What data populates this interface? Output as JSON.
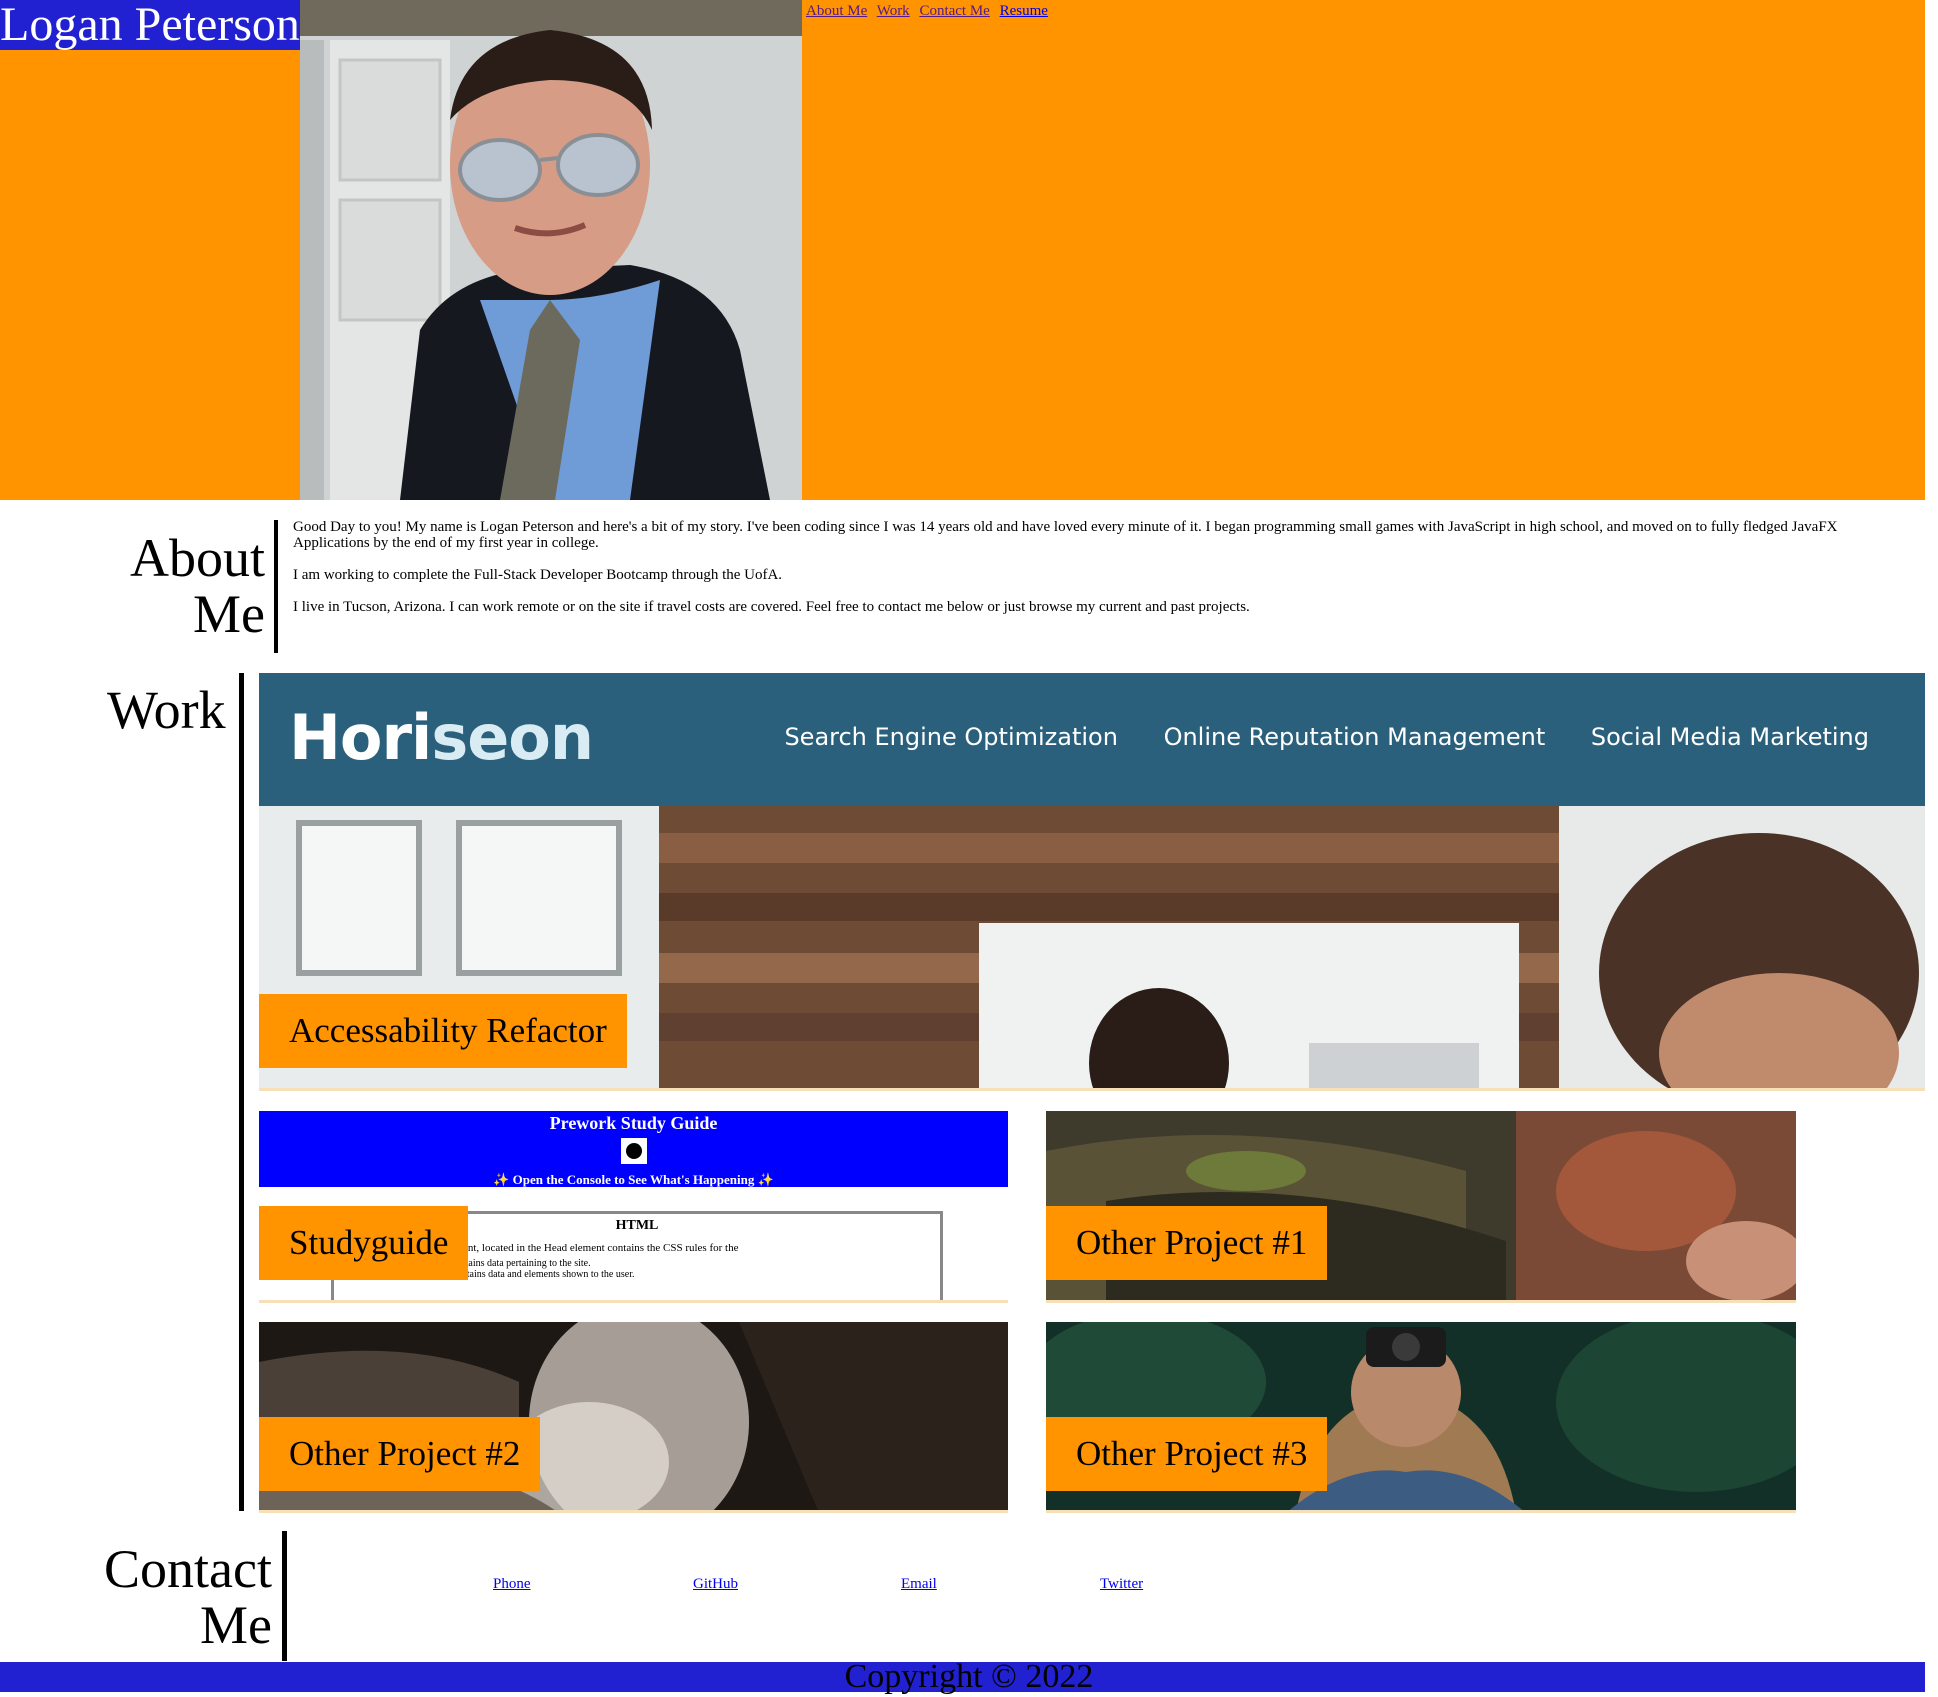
{
  "header": {
    "name": "Logan Peterson",
    "portrait_alt": "portrait photo",
    "nav": [
      {
        "label": "About Me"
      },
      {
        "label": "Work"
      },
      {
        "label": "Contact Me"
      },
      {
        "label": "Resume"
      }
    ]
  },
  "about": {
    "title_line1": "About",
    "title_line2": "Me",
    "paragraphs": [
      "Good Day to you! My name is Logan Peterson and here's a bit of my story. I've been coding since I was 14 years old and have loved every minute of it. I began programming small games with JavaScript in high school, and moved on to fully fledged JavaFX Applications by the end of my first year in college.",
      "I am working to complete the Full-Stack Developer Bootcamp through the UofA.",
      "I live in Tucson, Arizona. I can work remote or on the site if travel costs are covered. Feel free to contact me below or just browse my current and past projects."
    ]
  },
  "work": {
    "title": "Work",
    "featured": {
      "label": "Accessability Refactor",
      "logo_a": "Hori",
      "logo_b": "seon",
      "nav": [
        "Search Engine Optimization",
        "Online Reputation Management",
        "Social Media Marketing"
      ]
    },
    "studyguide": {
      "label": "Studyguide",
      "page_title": "Prework Study Guide",
      "page_sub": "✨ Open the Console to See What's Happening ✨",
      "box_title": "HTML",
      "box_line": "t (Internal CSS): This element, located in the Head element contains the CSS rules for the",
      "box_item1": "The 'head' element contains data pertaining to the site.",
      "box_item2": "The 'body' element contains data and elements shown to the user."
    },
    "projects": [
      {
        "label": "Other Project #1"
      },
      {
        "label": "Other Project #2"
      },
      {
        "label": "Other Project #3"
      }
    ]
  },
  "contact": {
    "title_line1": "Contact",
    "title_line2": "Me",
    "links": [
      "Phone",
      "GitHub",
      "Email",
      "Twitter"
    ]
  },
  "footer": {
    "copyright": "Copyright © 2022"
  },
  "colors": {
    "header_bg": "#ff9300",
    "name_bg": "#2121d1",
    "horiseon_bar": "#2a607c",
    "label_bg": "#ff9300"
  }
}
